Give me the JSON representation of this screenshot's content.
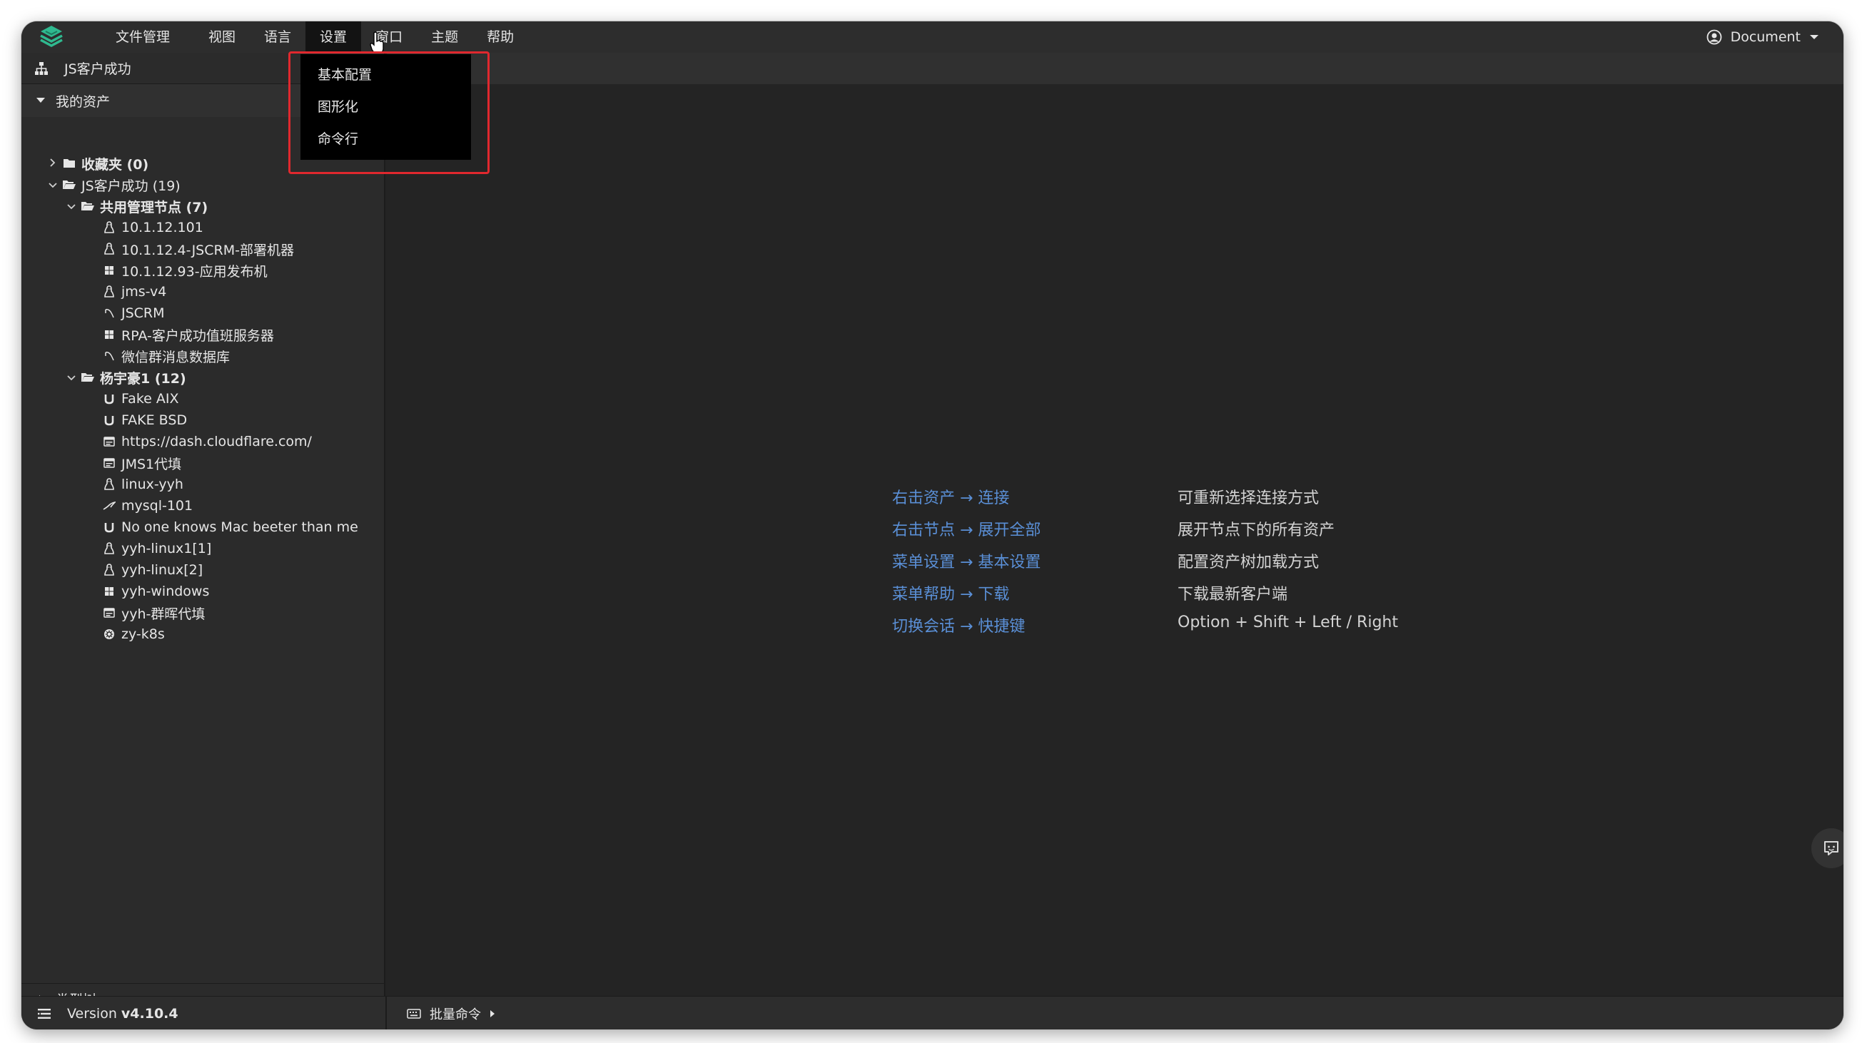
{
  "menubar": {
    "items": [
      "文件管理",
      "视图",
      "语言",
      "设置",
      "窗口",
      "主题",
      "帮助"
    ],
    "active_index": 3,
    "user_label": "Document"
  },
  "settings_menu": {
    "items": [
      "基本配置",
      "图形化",
      "命令行"
    ]
  },
  "sidebar": {
    "header_title": "JS客户成功",
    "section_title": "我的资产",
    "tree": [
      {
        "level": 0,
        "chevron": "right",
        "icon": "folder-closed-icon",
        "label": "收藏夹 (0)",
        "bold": true
      },
      {
        "level": 0,
        "chevron": "down",
        "icon": "folder-open-icon",
        "label": "JS客户成功 (19)",
        "bold": false
      },
      {
        "level": 1,
        "chevron": "down",
        "icon": "folder-open-icon",
        "label": "共用管理节点 (7)",
        "bold": true
      },
      {
        "level": 2,
        "icon": "linux-icon",
        "label": "10.1.12.101"
      },
      {
        "level": 2,
        "icon": "linux-icon",
        "label": "10.1.12.4-JSCRM-部署机器"
      },
      {
        "level": 2,
        "icon": "windows-icon",
        "label": "10.1.12.93-应用发布机"
      },
      {
        "level": 2,
        "icon": "linux-icon",
        "label": "jms-v4"
      },
      {
        "level": 2,
        "icon": "database-icon",
        "label": "JSCRM"
      },
      {
        "level": 2,
        "icon": "windows-icon",
        "label": "RPA-客户成功值班服务器"
      },
      {
        "level": 2,
        "icon": "database-icon",
        "label": "微信群消息数据库"
      },
      {
        "level": 1,
        "chevron": "down",
        "icon": "folder-open-icon",
        "label": "杨宇豪1 (12)",
        "bold": true
      },
      {
        "level": 2,
        "icon": "unix-icon",
        "label": "Fake AIX"
      },
      {
        "level": 2,
        "icon": "unix-icon",
        "label": "FAKE BSD"
      },
      {
        "level": 2,
        "icon": "website-icon",
        "label": "https://dash.cloudflare.com/"
      },
      {
        "level": 2,
        "icon": "website-icon",
        "label": "JMS1代填"
      },
      {
        "level": 2,
        "icon": "linux-icon",
        "label": "linux-yyh"
      },
      {
        "level": 2,
        "icon": "mysql-icon",
        "label": "mysql-101"
      },
      {
        "level": 2,
        "icon": "unix-icon",
        "label": "No one knows Mac beeter than me"
      },
      {
        "level": 2,
        "icon": "linux-icon",
        "label": "yyh-linux1[1]"
      },
      {
        "level": 2,
        "icon": "linux-icon",
        "label": "yyh-linux[2]"
      },
      {
        "level": 2,
        "icon": "windows-icon",
        "label": "yyh-windows"
      },
      {
        "level": 2,
        "icon": "website-icon",
        "label": "yyh-群晖代填"
      },
      {
        "level": 2,
        "icon": "kubernetes-icon",
        "label": "zy-k8s"
      }
    ],
    "type_tree_title": "类型树"
  },
  "hints": [
    {
      "action": "右击资产 → 连接",
      "description": "可重新选择连接方式"
    },
    {
      "action": "右击节点 → 展开全部",
      "description": "展开节点下的所有资产"
    },
    {
      "action": "菜单设置 → 基本设置",
      "description": "配置资产树加载方式"
    },
    {
      "action": "菜单帮助 → 下载",
      "description": "下载最新客户端"
    },
    {
      "action": "切换会话 → 快捷键",
      "description": "Option + Shift + Left / Right"
    }
  ],
  "statusbar": {
    "version_label": "Version",
    "version_value": "v4.10.4",
    "batch_command": "批量命令"
  },
  "colors": {
    "accent": "#5a8fd6",
    "highlight": "#e0282e",
    "logo": "#2fb98f"
  }
}
